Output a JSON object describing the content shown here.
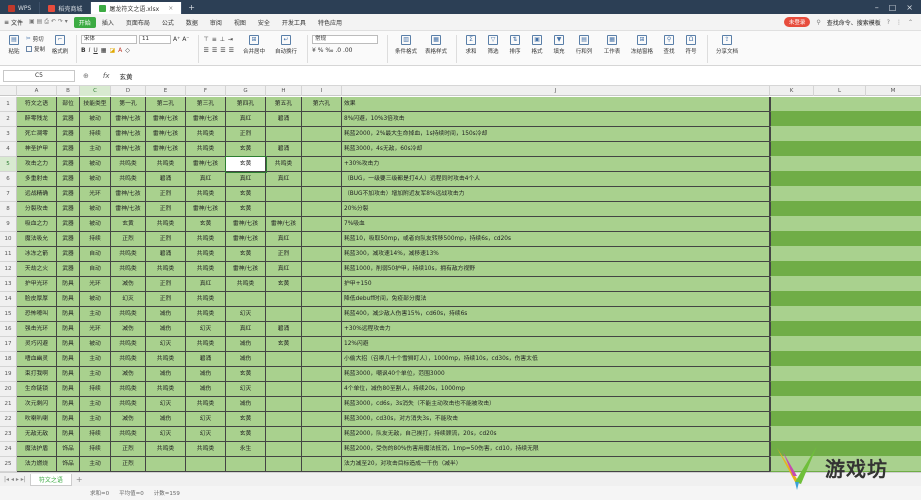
{
  "titlebar": {
    "tabs": [
      {
        "label": "WPS",
        "active": false
      },
      {
        "label": "稻壳商城",
        "active": false
      },
      {
        "label": "屠龙符文之语.xlsx",
        "active": true
      }
    ]
  },
  "menubar": {
    "file_label": "文件",
    "items": [
      "开始",
      "插入",
      "页面布局",
      "公式",
      "数据",
      "审阅",
      "视图",
      "安全",
      "开发工具",
      "特色应用"
    ],
    "active_item": "开始",
    "unlogin_label": "未登录",
    "search_label": "查找命令、搜索模板"
  },
  "ribbon": {
    "paste_label": "粘贴",
    "cut_label": "剪切",
    "copy_label": "复制",
    "format_brush_label": "格式刷",
    "font_name": "宋体",
    "font_size": "11",
    "merge_label": "合并居中",
    "wrap_label": "自动换行",
    "number_format": "常规",
    "cond_format_label": "条件格式",
    "table_style_label": "表格样式",
    "sum_label": "求和",
    "filter_label": "筛选",
    "sort_label": "排序",
    "format_label": "格式",
    "fill_label": "填充",
    "rowcol_label": "行和列",
    "sheet_label": "工作表",
    "freeze_label": "冻结窗格",
    "find_label": "查找",
    "symbol_label": "符号",
    "share_label": "分享文档"
  },
  "formula_bar": {
    "cell_ref": "C5",
    "fx_label": "fx",
    "value": "玄黄"
  },
  "columns": [
    "A",
    "B",
    "C",
    "D",
    "E",
    "F",
    "G",
    "H",
    "I",
    "J",
    "K",
    "L",
    "M"
  ],
  "header_row": [
    "符文之语",
    "部位",
    "技能类型",
    "第一孔",
    "第二孔",
    "第三孔",
    "第四孔",
    "第五孔",
    "第六孔",
    "效果"
  ],
  "rows": [
    [
      "醉零残龙",
      "武器",
      "被动",
      "雷神/七孩",
      "雷神/七孩",
      "雷神/七孩",
      "真红",
      "碧涌",
      "",
      "8%闪避，10%3倍攻击"
    ],
    [
      "死亡凋零",
      "武器",
      "持续",
      "雷神/七孩",
      "雷神/七孩",
      "共鸣类",
      "正烈",
      "",
      "",
      "耗蓝2000，2%最大生命掉血，1s持续时间，150s冷却"
    ],
    [
      "神圣护甲",
      "武器",
      "主动",
      "雷神/七孩",
      "雷神/七孩",
      "共鸣类",
      "玄黄",
      "碧涌",
      "",
      "耗蓝3000，4s无敌，60s冷却"
    ],
    [
      "攻击之力",
      "武器",
      "被动",
      "共鸣类",
      "共鸣类",
      "雷神/七孩",
      "玄黄",
      "共鸣类",
      "",
      "+30%攻击力"
    ],
    [
      "多重射击",
      "武器",
      "被动",
      "共鸣类",
      "碧涌",
      "真红",
      "真红",
      "真红",
      "",
      "（BUG，一级要三级都是打4人）远程同时攻击4个人"
    ],
    [
      "远战精确",
      "武器",
      "光环",
      "雷神/七孩",
      "正烈",
      "共鸣类",
      "玄黄",
      "",
      "",
      "（BUG不加攻击）增加附近友军8%远战攻击力"
    ],
    [
      "分裂攻击",
      "武器",
      "被动",
      "雷神/七孩",
      "正烈",
      "雷神/七孩",
      "玄黄",
      "",
      "",
      "20%分裂"
    ],
    [
      "吸血之力",
      "武器",
      "被动",
      "玄黄",
      "共鸣类",
      "玄黄",
      "雷神/七孩",
      "雷神/七孩",
      "",
      "7%吸血"
    ],
    [
      "魔法吸允",
      "武器",
      "持续",
      "正烈",
      "正烈",
      "共鸣类",
      "雷神/七孩",
      "真红",
      "",
      "耗蓝10，吸取50mp，或者向队友转移500mp，持续6s，cd20s"
    ],
    [
      "冰冻之箭",
      "武器",
      "自动",
      "共鸣类",
      "碧涌",
      "共鸣类",
      "玄黄",
      "正烈",
      "",
      "耗蓝300，减攻速14%，减移速13%"
    ],
    [
      "天劫之火",
      "武器",
      "自动",
      "共鸣类",
      "共鸣类",
      "共鸣类",
      "雷神/七孩",
      "真红",
      "",
      "耗蓝1000，削弱50护甲，持续10s，拥有敌方视野"
    ],
    [
      "护甲光环",
      "防具",
      "光环",
      "减伤",
      "正烈",
      "真红",
      "共鸣类",
      "玄黄",
      "",
      "护甲+150"
    ],
    [
      "脸皮厚厚",
      "防具",
      "被动",
      "幻灭",
      "正烈",
      "共鸣类",
      "",
      "",
      "",
      "降低debuff时间，免疫部分魔法"
    ],
    [
      "恐怖嚎叫",
      "防具",
      "主动",
      "共鸣类",
      "减伤",
      "共鸣类",
      "幻灭",
      "",
      "",
      "耗蓝400，减少敌人伤害15%，cd60s，持续6s"
    ],
    [
      "强击光环",
      "防具",
      "光环",
      "减伤",
      "减伤",
      "幻灭",
      "真红",
      "碧涌",
      "",
      "+30%远程攻击力"
    ],
    [
      "灵巧闪避",
      "防具",
      "被动",
      "共鸣类",
      "幻灭",
      "共鸣类",
      "减伤",
      "玄黄",
      "",
      "12%闪避"
    ],
    [
      "嗜血幽灵",
      "防具",
      "主动",
      "共鸣类",
      "共鸣类",
      "碧涌",
      "减伤",
      "",
      "",
      "小偷大招（召唤几十个雪狮盯人），1000mp，持续10s，cd30s，伤害太低"
    ],
    [
      "束打我啊",
      "防具",
      "主动",
      "减伤",
      "减伤",
      "减伤",
      "玄黄",
      "",
      "",
      "耗蓝3000，嘲讽40个单位，范围3000"
    ],
    [
      "生命链锁",
      "防具",
      "持续",
      "共鸣类",
      "共鸣类",
      "减伤",
      "幻灭",
      "",
      "",
      "4个单位，减伤80至割人，持续20s，1000mp"
    ],
    [
      "次元剩闪",
      "防具",
      "主动",
      "共鸣类",
      "幻灭",
      "共鸣类",
      "减伤",
      "",
      "",
      "耗蓝3000，cd6s，3s消失（不能主动攻击也不能被攻击）"
    ],
    [
      "吹喇叭喇",
      "防具",
      "主动",
      "减伤",
      "减伤",
      "幻灭",
      "玄黄",
      "",
      "",
      "耗蓝3000，cd30s，对方消失3s，不能攻击"
    ],
    [
      "无敌无敌",
      "防具",
      "持续",
      "共鸣类",
      "幻灭",
      "幻灭",
      "玄黄",
      "",
      "",
      "耗蓝2000，队友无敌，自己挨打，持续顾流，20s，cd20s"
    ],
    [
      "魔法护盾",
      "饰品",
      "持续",
      "正烈",
      "共鸣类",
      "共鸣类",
      "永生",
      "",
      "",
      "耗蓝2000，受伤的80%伤害用魔法抵消，1mp=50伤害，cd10，持续无限"
    ],
    [
      "法力燃烧",
      "饰品",
      "主动",
      "正烈",
      "",
      "",
      "",
      "",
      "",
      "法力减至20，对攻击目标造成一千伤（减半）"
    ]
  ],
  "sheet_tab": "符文之语",
  "status": {
    "sum": "求和=0",
    "avg": "平均值=0",
    "count": "计数=159"
  },
  "watermark_text": "游戏坊",
  "colors": {
    "accent": "#3cab43",
    "cell_fill": "#a9d18e",
    "cell_dark": "#70ad47",
    "titlebar": "#2c3f55"
  }
}
